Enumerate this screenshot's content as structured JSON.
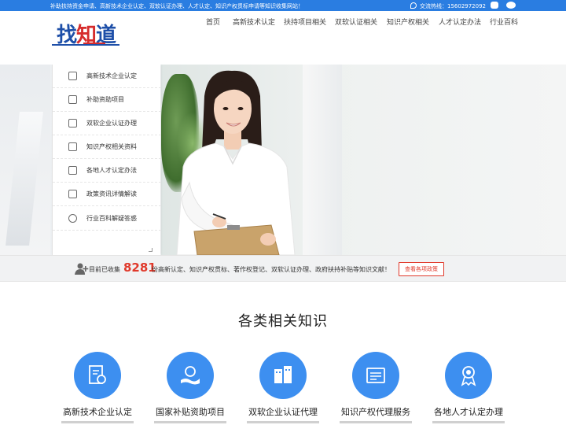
{
  "topbar": {
    "notice": "补助扶持资金申请、高新技术企业认定、双软认证办理、人才认定、知识产权贯标申请等知识收集网站！",
    "hotline_label": "交流热线：15602972092",
    "icons": [
      "phone-icon",
      "qq-icon",
      "wechat-icon"
    ]
  },
  "logo": {
    "part1": "找",
    "part2": "知",
    "part3": "道"
  },
  "nav": [
    "首页",
    "高新技术认定",
    "扶持项目相关",
    "双软认证相关",
    "知识产权相关",
    "人才认定办法",
    "行业百科"
  ],
  "sidemenu": [
    {
      "label": "高新技术企业认定",
      "icon": "certificate-icon"
    },
    {
      "label": "补助资助项目",
      "icon": "subsidy-icon"
    },
    {
      "label": "双软企业认证办理",
      "icon": "software-icon"
    },
    {
      "label": "知识产权相关资料",
      "icon": "document-icon"
    },
    {
      "label": "各地人才认定办法",
      "icon": "talent-icon"
    },
    {
      "label": "政策资讯详情解读",
      "icon": "policy-icon"
    },
    {
      "label": "行业百科解疑答惑",
      "icon": "faq-icon"
    }
  ],
  "stats": {
    "prefix": "目前已收集",
    "count": "8281",
    "suffix": "份高新认定、知识产权贯标、著作权登记、双软认证办理、政府扶持补贴等知识文献！",
    "button": "查看各项政策"
  },
  "section": {
    "title": "各类相关知识",
    "cards": [
      {
        "title": "高新技术企业认定",
        "icon": "certificate-icon"
      },
      {
        "title": "国家补贴资助项目",
        "icon": "subsidy-icon"
      },
      {
        "title": "双软企业认证代理",
        "icon": "software-icon"
      },
      {
        "title": "知识产权代理服务",
        "icon": "ip-icon"
      },
      {
        "title": "各地人才认定办理",
        "icon": "talent-icon"
      }
    ]
  },
  "colors": {
    "brand_blue": "#2a7de1",
    "accent_red": "#e0392b",
    "icon_circle": "#3d8ff0"
  }
}
